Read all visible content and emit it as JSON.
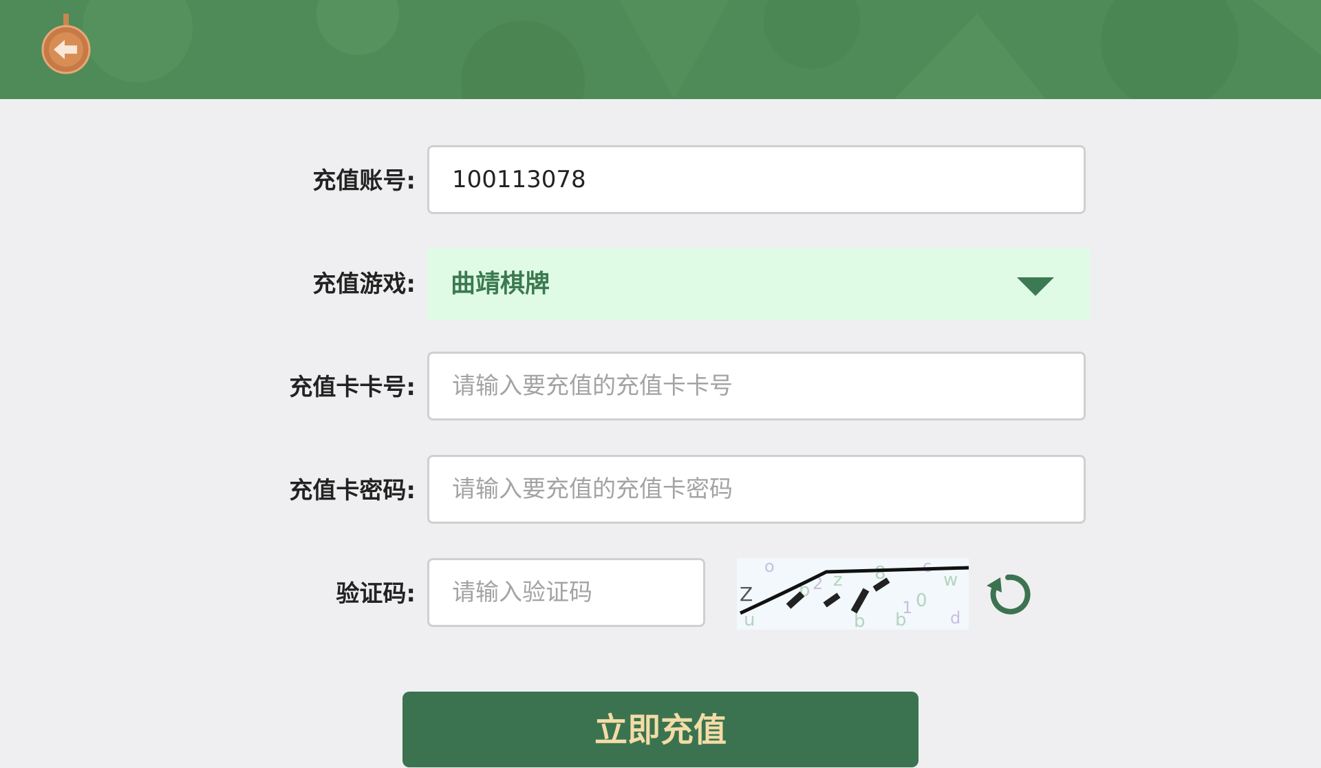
{
  "header": {
    "back_icon": "back-arrow-icon"
  },
  "form": {
    "account": {
      "label": "充值账号:",
      "value": "100113078"
    },
    "game": {
      "label": "充值游戏:",
      "selected": "曲靖棋牌",
      "icon": "dropdown-arrow-icon"
    },
    "card_number": {
      "label": "充值卡卡号:",
      "placeholder": "请输入要充值的充值卡卡号"
    },
    "card_password": {
      "label": "充值卡密码:",
      "placeholder": "请输入要充值的充值卡密码"
    },
    "captcha": {
      "label": "验证码:",
      "placeholder": "请输入验证码",
      "refresh_icon": "refresh-icon"
    }
  },
  "submit_label": "立即充值",
  "colors": {
    "header_green": "#4e8a57",
    "primary_green": "#3b7350",
    "select_bg": "#e0fbe5",
    "submit_text": "#f3dca6",
    "page_bg": "#efeff1"
  }
}
